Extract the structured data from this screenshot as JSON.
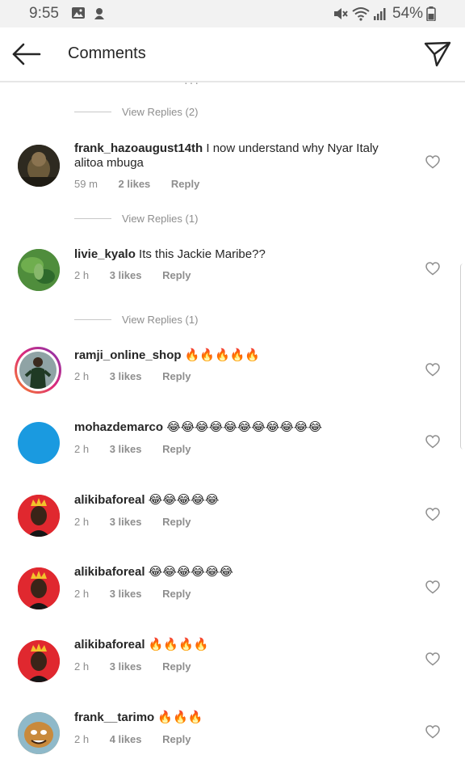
{
  "status_bar": {
    "time": "9:55",
    "battery": "54%",
    "icons": [
      "gallery-icon",
      "app-icon",
      "mute-icon",
      "wifi-icon",
      "signal-icon",
      "battery-icon"
    ]
  },
  "header": {
    "title": "Comments",
    "back_icon": "back-arrow-icon",
    "send_icon": "send-icon"
  },
  "comments": [
    {
      "view_replies_above": "View Replies (2)",
      "username": "frank_hazoaugust14th",
      "text": " I now understand why Nyar Italy alitoa mbuga",
      "time": "59 m",
      "likes": "2 likes",
      "reply": "Reply",
      "avatar_color": "#3b3426"
    },
    {
      "view_replies_above": "View Replies (1)",
      "username": "livie_kyalo",
      "text": " Its this Jackie Maribe??",
      "time": "2 h",
      "likes": "3 likes",
      "reply": "Reply",
      "avatar_color": "#4e8a3a"
    },
    {
      "view_replies_above": "View Replies (1)",
      "username": "ramji_online_shop",
      "text": " 🔥🔥🔥🔥🔥",
      "time": "2 h",
      "likes": "3 likes",
      "reply": "Reply",
      "avatar_color": "#7a8f92"
    },
    {
      "username": "mohazdemarco",
      "text": " 😂😂😂😂😂😂😂😂😂😂😂",
      "time": "2 h",
      "likes": "3 likes",
      "reply": "Reply",
      "avatar_color": "#1a9ae0"
    },
    {
      "username": "alikibaforeal",
      "text": " 😂😂😂😂😂",
      "time": "2 h",
      "likes": "3 likes",
      "reply": "Reply",
      "avatar_color": "#e0282f"
    },
    {
      "username": "alikibaforeal",
      "text": " 😂😂😂😂😂😂",
      "time": "2 h",
      "likes": "3 likes",
      "reply": "Reply",
      "avatar_color": "#e0282f"
    },
    {
      "username": "alikibaforeal",
      "text": " 🔥🔥🔥🔥",
      "time": "2 h",
      "likes": "3 likes",
      "reply": "Reply",
      "avatar_color": "#e0282f"
    },
    {
      "username": "frank__tarimo",
      "text": " 🔥🔥🔥",
      "time": "2 h",
      "likes": "4 likes",
      "reply": "Reply",
      "avatar_color": "#c98a3c"
    }
  ],
  "colors": {
    "meta_gray": "#8e8e8e",
    "text": "#262626",
    "story_ring": "#dd2a7b"
  }
}
